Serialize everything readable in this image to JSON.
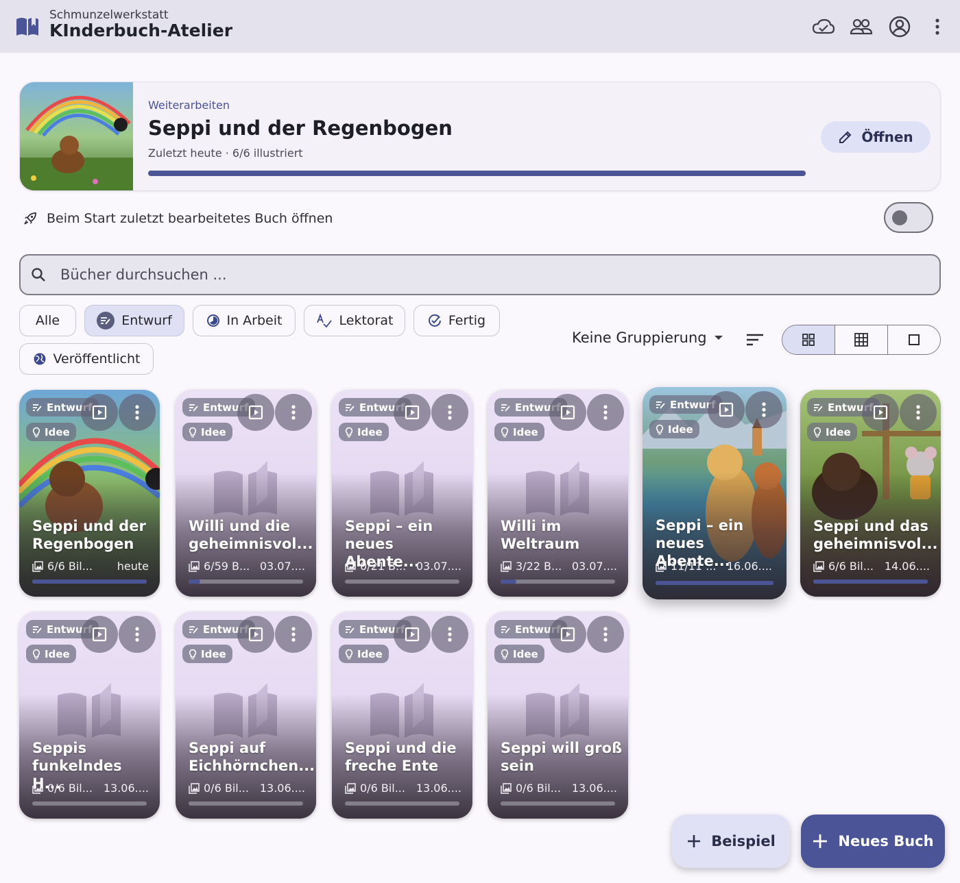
{
  "app": {
    "subtitle": "Schmunzelwerkstatt",
    "title": "KInderbuch-Atelier"
  },
  "toolbar_icons": [
    "cloud-sync-icon",
    "people-icon",
    "account-icon",
    "more-vert-icon"
  ],
  "continue": {
    "kicker": "Weiterarbeiten",
    "title": "Seppi und der Regenbogen",
    "meta": "Zuletzt heute · 6/6 illustriert",
    "progress": 1.0,
    "open_label": "Öffnen"
  },
  "startup": {
    "label": "Beim Start zuletzt bearbeitetes Buch öffnen",
    "enabled": false
  },
  "search": {
    "placeholder": "Bücher durchsuchen ..."
  },
  "filters": [
    {
      "label": "Alle",
      "icon": "",
      "selected": false
    },
    {
      "label": "Entwurf",
      "icon": "draft-icon",
      "selected": true
    },
    {
      "label": "In Arbeit",
      "icon": "progress-icon",
      "selected": false
    },
    {
      "label": "Lektorat",
      "icon": "spellcheck-icon",
      "selected": false
    },
    {
      "label": "Fertig",
      "icon": "check-circle-icon",
      "selected": false
    },
    {
      "label": "Veröffentlicht",
      "icon": "globe-icon",
      "selected": false
    }
  ],
  "grouping": {
    "label": "Keine Gruppierung"
  },
  "view_modes": [
    {
      "icon": "grid-large-icon",
      "active": true
    },
    {
      "icon": "grid-small-icon",
      "active": false
    },
    {
      "icon": "single-view-icon",
      "active": false
    }
  ],
  "books": [
    {
      "status": "Entwurf",
      "stage": "Idee",
      "title": "Seppi und der Regenbogen",
      "count": "6/6 Bil...",
      "date": "heute",
      "progress": 1.0,
      "cover": "rainbow"
    },
    {
      "status": "Entwurf",
      "stage": "Idee",
      "title": "Willi und die geheimnisvol...",
      "count": "6/59 B...",
      "date": "03.07....",
      "progress": 0.1,
      "cover": "none"
    },
    {
      "status": "Entwurf",
      "stage": "Idee",
      "title": "Seppi – ein neues Abente...",
      "count": "0/21 B...",
      "date": "03.07....",
      "progress": 0.0,
      "cover": "none"
    },
    {
      "status": "Entwurf",
      "stage": "Idee",
      "title": "Willi im Weltraum",
      "count": "3/22 B...",
      "date": "03.07....",
      "progress": 0.14,
      "cover": "none"
    },
    {
      "status": "Entwurf",
      "stage": "Idee",
      "title": "Seppi – ein neues Abente...",
      "count": "11/11 ...",
      "date": "16.06....",
      "progress": 1.0,
      "cover": "lake"
    },
    {
      "status": "Entwurf",
      "stage": "Idee",
      "title": "Seppi und das geheimnisvol...",
      "count": "6/6 Bil...",
      "date": "14.06....",
      "progress": 1.0,
      "cover": "garden"
    },
    {
      "status": "Entwurf",
      "stage": "Idee",
      "title": "Seppis funkelndes H...",
      "count": "0/6 Bil...",
      "date": "13.06....",
      "progress": 0.0,
      "cover": "none"
    },
    {
      "status": "Entwurf",
      "stage": "Idee",
      "title": "Seppi auf Eichhörnchen...",
      "count": "0/6 Bil...",
      "date": "13.06....",
      "progress": 0.0,
      "cover": "none"
    },
    {
      "status": "Entwurf",
      "stage": "Idee",
      "title": "Seppi und die freche Ente",
      "count": "0/6 Bil...",
      "date": "13.06....",
      "progress": 0.0,
      "cover": "none"
    },
    {
      "status": "Entwurf",
      "stage": "Idee",
      "title": "Seppi will groß sein",
      "count": "0/6 Bil...",
      "date": "13.06....",
      "progress": 0.0,
      "cover": "none"
    }
  ],
  "fabs": {
    "example_label": "Beispiel",
    "new_label": "Neues Buch"
  },
  "colors": {
    "accent": "#4b5596",
    "topbar": "#e4e2ec",
    "card_bg": "#e8def4"
  }
}
